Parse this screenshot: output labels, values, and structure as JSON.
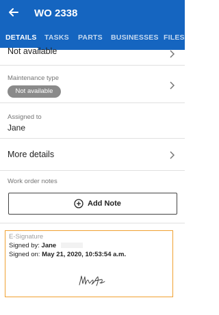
{
  "appbar": {
    "title": "WO 2338",
    "back_icon": "arrow-left-icon",
    "color": "#1565c0"
  },
  "tabs": [
    {
      "label": "DETAILS",
      "active": true
    },
    {
      "label": "TASKS",
      "active": false
    },
    {
      "label": "PARTS",
      "active": false
    },
    {
      "label": "BUSINESSES",
      "active": false
    },
    {
      "label": "FILES",
      "active": false
    }
  ],
  "details": {
    "top_value": "Not available",
    "maintenance_type": {
      "label": "Maintenance type",
      "value": "Not available"
    },
    "assigned_to": {
      "label": "Assigned to",
      "value": "Jane"
    },
    "more_details": "More details",
    "notes": {
      "label": "Work order notes",
      "add_note": "Add Note"
    }
  },
  "esignature": {
    "heading": "E-Signature",
    "signed_by_label": "Signed by:",
    "signed_by_value": "Jane",
    "signed_on_label": "Signed on:",
    "signed_on_value": "May 21, 2020, 10:53:54 a.m.",
    "border_color": "#f0a030"
  }
}
